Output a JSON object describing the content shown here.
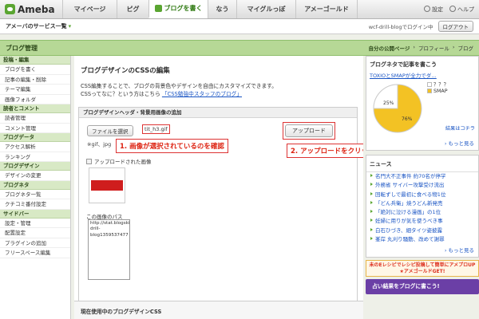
{
  "nav": {
    "logo": "Ameba",
    "tabs": [
      "マイページ",
      "ピグ",
      "ブログを書く",
      "なう",
      "マイグルっぽ",
      "アメーゴールド"
    ],
    "settings": "設定",
    "help": "ヘルプ"
  },
  "subbar": {
    "service_menu": "アメーバのサービス一覧",
    "login_status": "wcf-drill-blogでログイン中",
    "logout": "ログアウト"
  },
  "header": {
    "title": "ブログ管理",
    "links_label": "自分の公開ページ",
    "link_profile": "プロフィール",
    "link_blog": "ブログ"
  },
  "sidebar": {
    "sections": [
      {
        "title": "投稿・編集",
        "items": [
          "ブログを書く",
          "記事の編集・削除",
          "テーマ編集",
          "画像フォルダ"
        ]
      },
      {
        "title": "読者とコメント",
        "items": [
          "読者管理",
          "コメント管理"
        ]
      },
      {
        "title": "ブログデータ",
        "items": [
          "アクセス解析",
          "ランキング"
        ]
      },
      {
        "title": "ブログデザイン",
        "items": [
          "デザインの変更"
        ]
      },
      {
        "title": "ブログネタ",
        "items": [
          "ブログネタ一覧",
          "クチコミ番付設定"
        ]
      },
      {
        "title": "サイドバー",
        "items": [
          "設定・管理",
          "配置設定",
          "プラグインの追加",
          "フリースペース編集"
        ]
      }
    ]
  },
  "main": {
    "title": "ブログデザインのCSSの編集",
    "desc1": "CSS編集することで、ブログの背景色やデザインを自由にカスタマイズできます。",
    "desc2": "CSSってなに？という方はこちら",
    "desc_link": "「CSS勉強中スタッフのブログ」",
    "panel_title": "ブログデザインヘッダ・背景用画像の追加",
    "file_button": "ファイルを選択",
    "file_name": "tit_h3.gif",
    "upload_button": "アップロード",
    "formats": "※gif、jpg",
    "callout1": "1. 画像が選択されているのを確認",
    "callout2": "2. アップロードをクリック",
    "uploaded_label": "アップロードされた画像",
    "path_label": "この画像のパス",
    "path_value": "http://stat.blogskin.ameba.jp/blogskin_images/20130130/14/eb/4a/j/o09800300wcf-drill-blog1359537477",
    "current_css": "現在使用中のブログデザインCSS"
  },
  "right": {
    "neta_title": "ブログネタで記事を書こう",
    "neta_topic": "TOXIOとSMAPが全力でダ…",
    "pie_legend": [
      "？？？",
      "SMAP"
    ],
    "pie_labels": [
      "25%",
      "76%"
    ],
    "vote_link": "結果はコチラ",
    "more": "もっと見る",
    "news_title": "ニュース",
    "news": [
      "名門大不正事件 約70名が停学",
      "外務省 サイバー攻撃受け流出",
      "回転ずしで最初に食べる物1位",
      "「どん兵衛」焼うどん新発売",
      "「絶対に泣ける漫画」の1位",
      "妊婦に用りが気を使うべき事",
      "白石ひづき、細タイツ姿披露",
      "峯岸 丸刈り騒動、改めて謝罪"
    ],
    "ad1": "未のEレシピでレシピ投稿して簡単にアメプロUP ★アメゴールドGET!",
    "ad2": "占い結果をブログに書こう!",
    "pie_colors": {
      "unknown": "#ffffff",
      "smap": "#f3c224"
    }
  }
}
